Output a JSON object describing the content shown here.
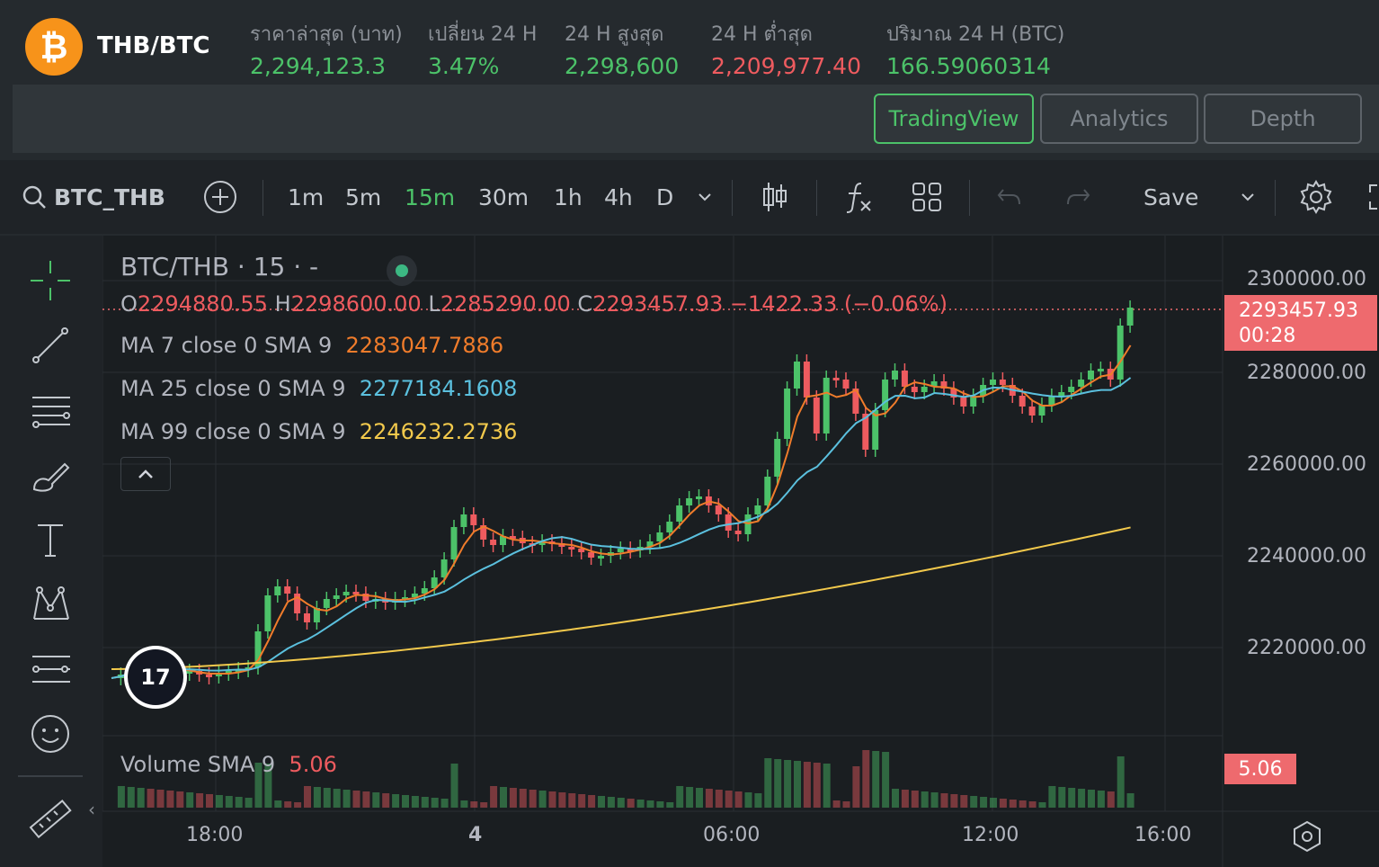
{
  "ticker": {
    "symbol_icon": "bitcoin-icon",
    "icon_glyph": "₿",
    "pair": "THB/BTC",
    "stats": [
      {
        "label": "ราคาล่าสุด (บาท)",
        "value": "2,294,123.3",
        "tone": "up"
      },
      {
        "label": "เปลี่ยน 24 H",
        "value": "3.47%",
        "tone": "up"
      },
      {
        "label": "24 H สูงสุด",
        "value": "2,298,600",
        "tone": "up"
      },
      {
        "label": "24 H ต่ำสุด",
        "value": "2,209,977.40",
        "tone": "down"
      },
      {
        "label": "ปริมาณ 24 H (BTC)",
        "value": "166.59060314",
        "tone": "up"
      }
    ]
  },
  "views": [
    "TradingView",
    "Analytics",
    "Depth"
  ],
  "toolbar": {
    "symbol": "BTC_THB",
    "intervals": [
      "1m",
      "5m",
      "15m",
      "30m",
      "1h",
      "4h",
      "D"
    ],
    "active_interval": "15m",
    "save_label": "Save"
  },
  "legend": {
    "title": "BTC/THB · 15 · -",
    "o_label": "O",
    "o": "2294880.55",
    "h_label": "H",
    "h": "2298600.00",
    "l_label": "L",
    "l": "2285290.00",
    "c_label": "C",
    "c": "2293457.93",
    "change": "−1422.33 (−0.06%)",
    "ma": [
      {
        "label": "MA 7 close 0 SMA 9",
        "value": "2283047.7886",
        "color": "#f07c2b"
      },
      {
        "label": "MA 25 close 0 SMA 9",
        "value": "2277184.1608",
        "color": "#5bc0de"
      },
      {
        "label": "MA 99 close 0 SMA 9",
        "value": "2246232.2736",
        "color": "#f2c94c"
      }
    ]
  },
  "price_axis": [
    "2300000.00",
    "2280000.00",
    "2260000.00",
    "2240000.00",
    "2220000.00"
  ],
  "current_price": {
    "value": "2293457.93",
    "countdown": "00:28"
  },
  "volume": {
    "label": "Volume SMA 9",
    "value": "5.06",
    "badge": "5.06"
  },
  "time_axis": [
    {
      "label": "18:00",
      "bold": false
    },
    {
      "label": "4",
      "bold": true
    },
    {
      "label": "06:00",
      "bold": false
    },
    {
      "label": "12:00",
      "bold": false
    },
    {
      "label": "16:00",
      "bold": false
    }
  ],
  "colors": {
    "up": "#4cc269",
    "down": "#ee5b5f",
    "ma7": "#f07c2b",
    "ma25": "#5bc0de",
    "ma99": "#f2c94c"
  }
}
